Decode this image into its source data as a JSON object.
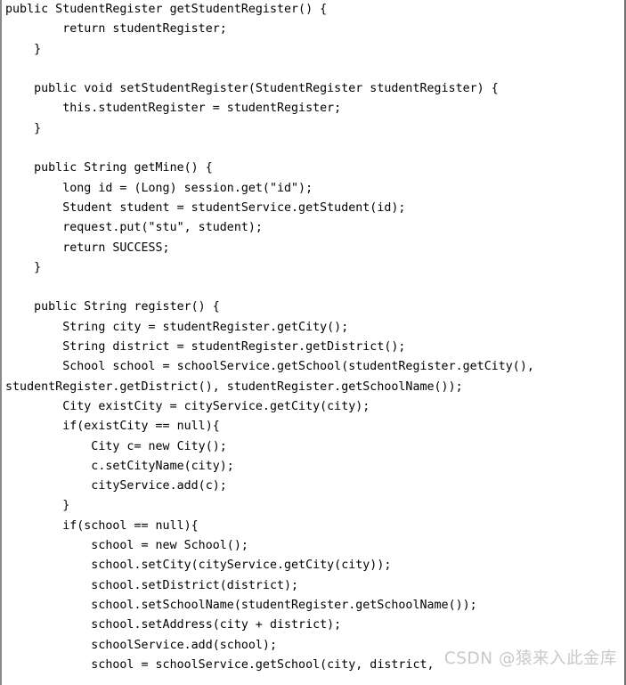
{
  "document": {
    "kind": "code-snippet",
    "language": "Java",
    "background_color": "#ffffff",
    "text_color": "#000000",
    "border_color": "#808080",
    "line_height_px": 22.3,
    "font_size_px": 13.3
  },
  "code": {
    "lines": [
      "public StudentRegister getStudentRegister() {",
      "        return studentRegister;",
      "    }",
      "",
      "    public void setStudentRegister(StudentRegister studentRegister) {",
      "        this.studentRegister = studentRegister;",
      "    }",
      "",
      "    public String getMine() {",
      "        long id = (Long) session.get(\"id\");",
      "        Student student = studentService.getStudent(id);",
      "        request.put(\"stu\", student);",
      "        return SUCCESS;",
      "    }",
      "",
      "    public String register() {",
      "        String city = studentRegister.getCity();",
      "        String district = studentRegister.getDistrict();",
      "        School school = schoolService.getSchool(studentRegister.getCity(),",
      "studentRegister.getDistrict(), studentRegister.getSchoolName());",
      "        City existCity = cityService.getCity(city);",
      "        if(existCity == null){",
      "            City c= new City();",
      "            c.setCityName(city);",
      "            cityService.add(c);",
      "        }",
      "        if(school == null){",
      "            school = new School();",
      "            school.setCity(cityService.getCity(city));",
      "            school.setDistrict(district);",
      "            school.setSchoolName(studentRegister.getSchoolName());",
      "            school.setAddress(city + district);",
      "            schoolService.add(school);",
      "            school = schoolService.getSchool(city, district,"
    ]
  },
  "watermark": {
    "text": "CSDN @猿来入此金库",
    "color": "#c9c9c9"
  }
}
